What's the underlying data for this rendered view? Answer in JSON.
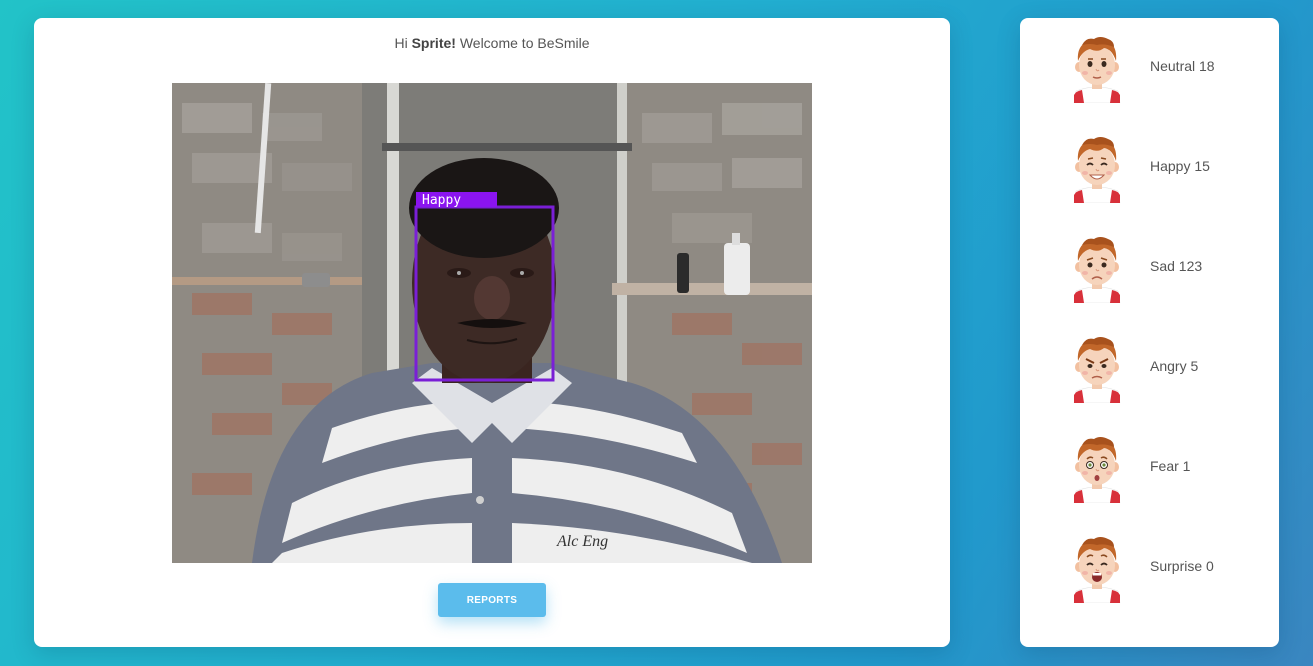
{
  "header": {
    "greeting_prefix": "Hi",
    "user_name": "Sprite!",
    "greeting_suffix": "Welcome to BeSmile"
  },
  "video": {
    "detected_emotion": "Happy",
    "shirt_text": "Alc Eng"
  },
  "actions": {
    "reports_label": "REPORTS"
  },
  "emotions": [
    {
      "name": "Neutral",
      "count": "18",
      "label": "Neutral 18",
      "icon": "neutral-face-icon"
    },
    {
      "name": "Happy",
      "count": "15",
      "label": "Happy 15",
      "icon": "happy-face-icon"
    },
    {
      "name": "Sad",
      "count": "123",
      "label": "Sad 123",
      "icon": "sad-face-icon"
    },
    {
      "name": "Angry",
      "count": "5",
      "label": "Angry 5",
      "icon": "angry-face-icon"
    },
    {
      "name": "Fear",
      "count": "1",
      "label": "Fear 1",
      "icon": "fear-face-icon"
    },
    {
      "name": "Surprise",
      "count": "0",
      "label": "Surprise 0",
      "icon": "surprise-face-icon"
    }
  ],
  "colors": {
    "accent": "#5bbcec",
    "detection_box": "#7a1fd6",
    "detection_label_bg": "#8b14f0"
  }
}
